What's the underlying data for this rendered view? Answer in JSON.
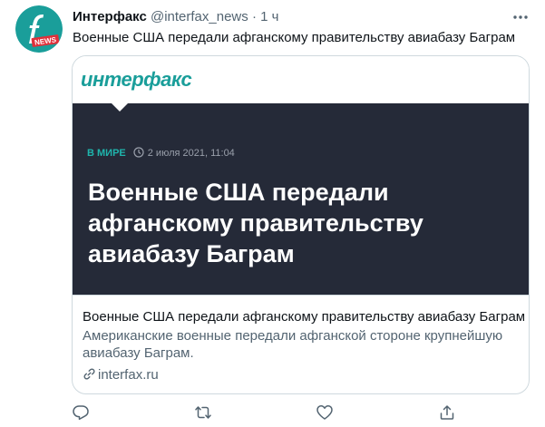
{
  "tweet": {
    "author_name": "Интерфакс",
    "author_handle": "@interfax_news",
    "separator": "·",
    "time": "1 ч",
    "text": "Военные США передали афганскому правительству авиабазу Баграм"
  },
  "card": {
    "brand": "интерфакс",
    "category": "В МИРЕ",
    "date": "2 июля 2021, 11:04",
    "headline_lines": [
      "Военные США передали",
      "афганскому правительству",
      "авиабазу Баграм"
    ],
    "title": "Военные США передали афганскому правительству авиабазу Баграм",
    "description": "Американские военные передали афганской стороне крупнейшую авиабазу Баграм.",
    "domain": "interfax.ru"
  },
  "icons": {
    "more": "more-horizontal-icon",
    "clock": "clock-icon",
    "link": "link-icon",
    "reply": "reply-icon",
    "retweet": "retweet-icon",
    "like": "heart-icon",
    "share": "share-icon"
  },
  "colors": {
    "brand_teal": "#1a9e9a",
    "card_dark": "#252a38",
    "secondary_text": "#536471",
    "avatar_accent": "#e0303a"
  }
}
